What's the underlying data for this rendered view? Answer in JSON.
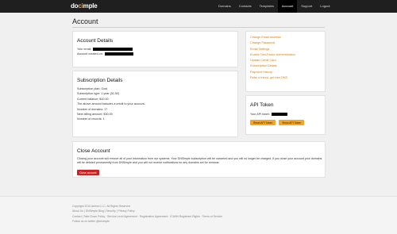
{
  "topbar": {
    "logo_pre": "do",
    "logo_mid": "ci",
    "logo_post": "mple",
    "nav": [
      {
        "label": "Domains",
        "active": false
      },
      {
        "label": "Contacts",
        "active": false
      },
      {
        "label": "Templates",
        "active": false
      },
      {
        "label": "Account",
        "active": true
      },
      {
        "label": "Support",
        "active": false
      },
      {
        "label": "Logout",
        "active": false
      }
    ]
  },
  "page": {
    "title": "Account"
  },
  "account": {
    "title": "Account Details",
    "email_label": "Your email:",
    "created_label": "Account created on:"
  },
  "subscription": {
    "title": "Subscription Details",
    "rows": [
      "Subscription plan: Gold",
      "Subscription type: 1 year (51.50)",
      "Current balance: $10.00",
      "The above amount includes a credit to your account.",
      "Number of domains: 17",
      "Next billing amount: $30.00",
      "Number of records: 1"
    ]
  },
  "links": [
    "Change Email Address",
    "Change Password",
    "Email Settings",
    "Enable Two-Factor Authentication",
    "Update Credit Card",
    "Subscription Details",
    "Payment History",
    "Refer a friend, get free DNS"
  ],
  "api": {
    "title": "API Token",
    "token_label": "Your API token:",
    "reset_label": "Reset API Token",
    "show_label": "Show API Token"
  },
  "close": {
    "title": "Close Account",
    "text": "Closing your account will remove all of your information from our systems. Your DNSimple subscription will be canceled and you will no longer be charged. If you close your account your domains will be deleted permanently from DNSimple and you will not receive notifications for any domains set for renewal.",
    "button_label": "Close account"
  },
  "footer": {
    "lines": [
      "Copyright 2010 Aetrion LLC. All Rights Reserved",
      "About Us | DNSimple Blog | Security | Privacy Policy",
      "Contact | Take Down Policy · Service Level Agreement · Registration Agreement · ICANN Registrant Rights · Terms of Service",
      "Follow us on twitter @dnsimple"
    ]
  },
  "colors": {
    "accent": "#f5a623",
    "danger": "#cc2222",
    "topbar": "#1f1f1f"
  }
}
